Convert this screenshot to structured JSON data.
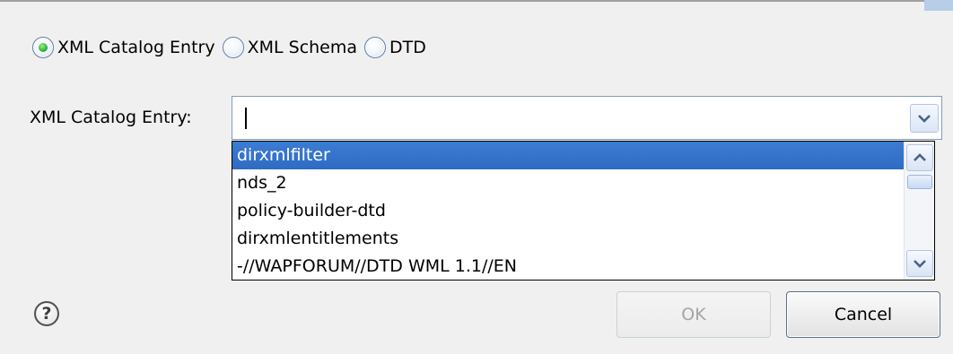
{
  "radio_group": {
    "options": [
      {
        "label": "XML Catalog Entry",
        "selected": true
      },
      {
        "label": "XML Schema",
        "selected": false
      },
      {
        "label": "DTD",
        "selected": false
      }
    ]
  },
  "field": {
    "label": "XML Catalog Entry:",
    "value": ""
  },
  "dropdown": {
    "items": [
      "dirxmlfilter",
      "nds_2",
      "policy-builder-dtd",
      "dirxmlentitlements",
      "-//WAPFORUM//DTD WML 1.1//EN"
    ],
    "selected_index": 0
  },
  "buttons": {
    "help": "?",
    "ok": "OK",
    "cancel": "Cancel"
  },
  "colors": {
    "selection": "#3d7cd3",
    "radio_selected": "#2fb23b"
  }
}
